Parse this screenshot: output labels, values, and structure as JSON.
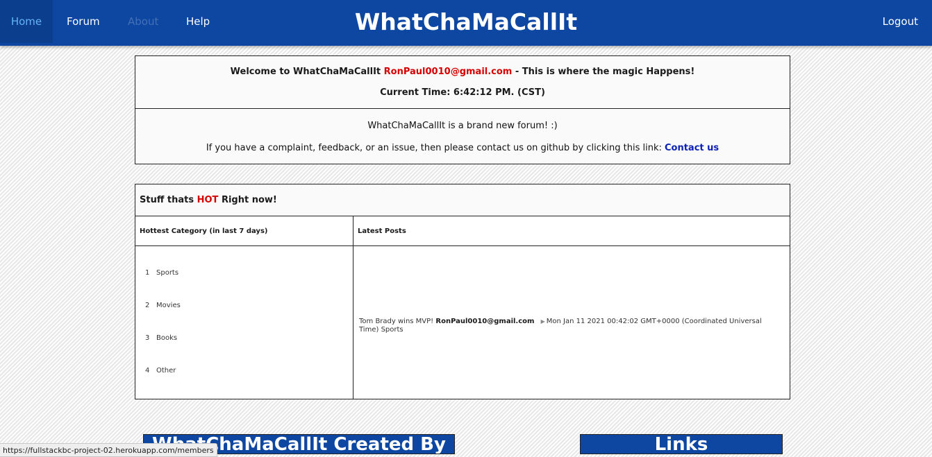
{
  "nav": {
    "home": "Home",
    "forum": "Forum",
    "about": "About",
    "help": "Help",
    "brand": "WhatChaMaCallIt",
    "logout": "Logout"
  },
  "welcome": {
    "prefix": "Welcome to WhatChaMaCallIt ",
    "email": "RonPaul0010@gmail.com",
    "suffix": " - This is where the magic Happens!",
    "time": "Current Time: 6:42:12 PM. (CST)"
  },
  "about": {
    "line1": "WhatChaMaCallIt is a brand new forum! :)",
    "line2": "If you have a complaint, feedback, or an issue, then please contact us on github by clicking this link: ",
    "contact": "Contact us"
  },
  "hot": {
    "title_prefix": "Stuff thats ",
    "title_hot": "HOT",
    "title_suffix": " Right now!",
    "category_header": "Hottest Category (in last 7 days)",
    "posts_header": "Latest Posts",
    "categories": [
      {
        "rank": "1",
        "name": "Sports"
      },
      {
        "rank": "2",
        "name": "Movies"
      },
      {
        "rank": "3",
        "name": "Books"
      },
      {
        "rank": "4",
        "name": "Other"
      }
    ],
    "post": {
      "title": "Tom Brady wins MVP!",
      "author": "RonPaul0010@gmail.com",
      "date": "Mon Jan 11 2021 00:42:02 GMT+0000 (Coordinated Universal Time)",
      "category": "Sports"
    }
  },
  "footer": {
    "created_by": "WhatChaMaCallIt Created By",
    "links": "Links"
  },
  "status_bar": {
    "url": "https://fullstackbc-project-02.herokuapp.com/members"
  },
  "colors": {
    "navbar": "#0d47a1",
    "active_link": "#64b5f6",
    "accent_red": "#d50000",
    "link_blue": "#0d22b5"
  },
  "icons": {
    "post_arrow": "triangle-right-icon"
  }
}
